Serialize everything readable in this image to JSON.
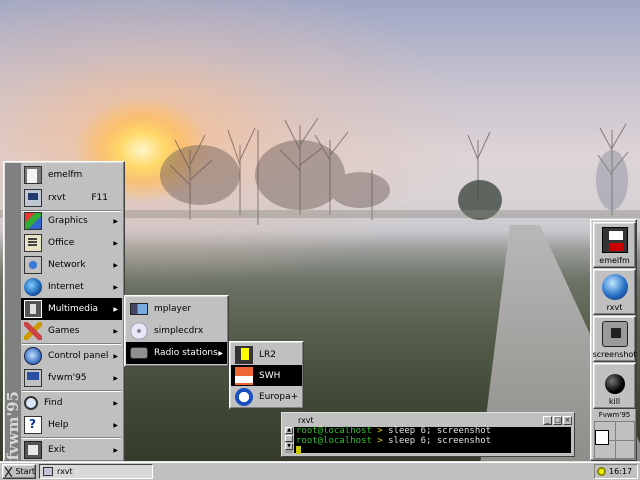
{
  "start_menu": {
    "banner": "fvwm'95",
    "items": [
      {
        "label": "emelfm",
        "icon": "file-manager-icon"
      },
      {
        "label": "rxvt",
        "accel": "F11",
        "icon": "terminal-icon"
      },
      {
        "label": "Graphics",
        "icon": "graphics-icon"
      },
      {
        "label": "Office",
        "icon": "office-icon"
      },
      {
        "label": "Network",
        "icon": "network-icon"
      },
      {
        "label": "Internet",
        "icon": "globe-icon"
      },
      {
        "label": "Multimedia",
        "icon": "multimedia-icon",
        "selected": true
      },
      {
        "label": "Games",
        "icon": "games-icon"
      },
      {
        "label": "Control panel",
        "icon": "control-panel-icon"
      },
      {
        "label": "fvwm'95",
        "icon": "fvwm-icon"
      },
      {
        "label": "Find",
        "icon": "find-icon"
      },
      {
        "label": "Help",
        "icon": "help-icon"
      },
      {
        "label": "Exit",
        "icon": "exit-icon"
      }
    ]
  },
  "multimedia_menu": {
    "items": [
      {
        "label": "mplayer",
        "icon": "mplayer-icon"
      },
      {
        "label": "simplecdrx",
        "icon": "cd-icon"
      },
      {
        "label": "Radio stations",
        "icon": "radio-icon",
        "selected": true
      }
    ]
  },
  "radio_menu": {
    "items": [
      {
        "label": "LR2",
        "icon": "lr2-logo-icon"
      },
      {
        "label": "SWH",
        "icon": "swh-logo-icon",
        "selected": true
      },
      {
        "label": "Europa+",
        "icon": "europa-plus-logo-icon"
      }
    ]
  },
  "dock": {
    "buttons": [
      {
        "label": "emelfm",
        "icon": "floppy-icon"
      },
      {
        "label": "rxvt",
        "icon": "globe-icon"
      },
      {
        "label": "screenshot",
        "icon": "camera-icon"
      },
      {
        "label": "kill",
        "icon": "bomb-icon"
      }
    ],
    "pager_title": "Fvwm'95"
  },
  "terminal": {
    "title": "rxvt",
    "lines": [
      {
        "prompt": "root@localhost",
        "sep": ">",
        "cmd": " sleep 6; screenshot"
      },
      {
        "prompt": "root@localhost",
        "sep": ">",
        "cmd": " sleep 6; screenshot"
      }
    ],
    "buttons": [
      "_",
      "□",
      "×"
    ]
  },
  "taskbar": {
    "start_label": "Start",
    "tasks": [
      {
        "label": "rxvt",
        "icon": "terminal-icon"
      }
    ],
    "clock": "16:17"
  },
  "colors": {
    "menu_bg": "#c0c0c0",
    "selection": "#000000",
    "prompt": "#2ec02e",
    "prompt_sep": "#e0d000"
  }
}
